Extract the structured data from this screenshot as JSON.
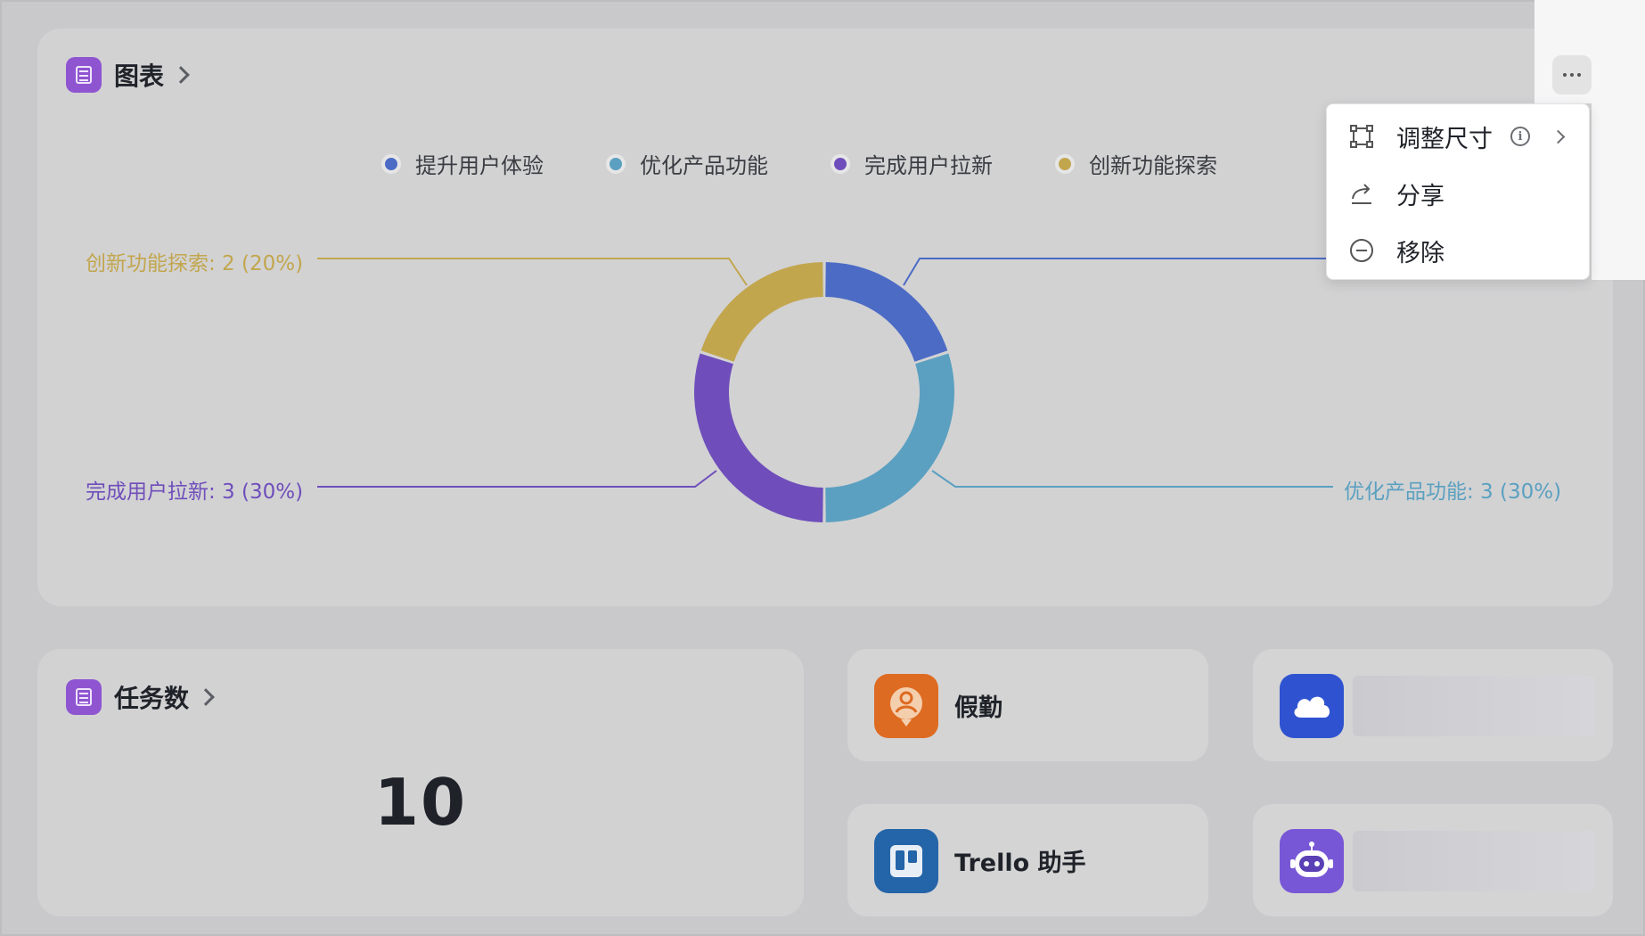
{
  "colors": {
    "series": [
      "#4c6bc5",
      "#5ba0c0",
      "#6f4ebb",
      "#c2a64e"
    ],
    "bi_icon": "#8f55d1",
    "leave_app": "#de6b22",
    "cloud_app": "#2f53d0",
    "trello_app": "#2464a8",
    "robot_app": "#7857d6"
  },
  "chart_card": {
    "title": "图表",
    "more_label": "···"
  },
  "chart_data": {
    "type": "pie",
    "donut": true,
    "legend_position": "top",
    "series": [
      {
        "name": "提升用户体验",
        "value": 2,
        "percent": 20
      },
      {
        "name": "优化产品功能",
        "value": 3,
        "percent": 30
      },
      {
        "name": "完成用户拉新",
        "value": 3,
        "percent": 30
      },
      {
        "name": "创新功能探索",
        "value": 2,
        "percent": 20
      }
    ],
    "callouts": [
      "创新功能探索: 2 (20%)",
      "完成用户拉新: 3 (30%)",
      "优化产品功能: 3 (30%)"
    ]
  },
  "context_menu": {
    "items": [
      {
        "label": "调整尺寸",
        "icon": "resize-icon"
      },
      {
        "label": "分享",
        "icon": "share-icon"
      },
      {
        "label": "移除",
        "icon": "remove-icon"
      }
    ]
  },
  "tasks_card": {
    "title": "任务数",
    "value": "10"
  },
  "apps": [
    {
      "name": "假勤",
      "icon": "leave-app-icon"
    },
    {
      "name": "",
      "icon": "cloud-icon"
    },
    {
      "name": "Trello 助手",
      "icon": "trello-icon"
    },
    {
      "name": "",
      "icon": "robot-icon"
    }
  ]
}
